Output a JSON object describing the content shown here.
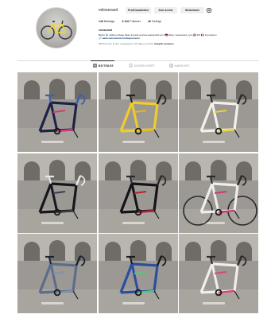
{
  "profile": {
    "username": "velosezard",
    "full_name": "velosezard",
    "avatar_alt": "Profilbild"
  },
  "buttons": {
    "edit_profile": "Profil bearbeiten",
    "archive": "Zum Archiv",
    "tools": "Werbetools"
  },
  "stats": {
    "posts_count": "143",
    "posts_label": "Beiträge",
    "followers_count": "3.126",
    "followers_label": "Follower",
    "following_count": "46",
    "following_label": "Gefolgt"
  },
  "bio": {
    "line1": "Berlin ⚙️ selling vintage bikes & parts at www.velosezard.com 🇩🇪 Ebay: velosezard_com 🇬🇧 FB: 🇫🇷 Impressum",
    "link": "www.velosezard.com/impressum"
  },
  "followed_by": {
    "text": "3600 Konten in den vergangenen 30 Tagen erreicht.",
    "cta": "Insights ansehen"
  },
  "tabs": [
    {
      "label": "BEITRÄGE",
      "icon": "grid-icon",
      "active": true
    },
    {
      "label": "GESPEICHERT",
      "icon": "bookmark-icon",
      "active": false
    },
    {
      "label": "MARKIERT",
      "icon": "tag-icon",
      "active": false
    }
  ],
  "posts": [
    {
      "alt": "pink and blue racing frame",
      "colors": {
        "main": "#1f2247",
        "accent": "#d9367a",
        "accent2": "#3a5fb5"
      }
    },
    {
      "alt": "yellow racing frame",
      "colors": {
        "main": "#f0cc2e",
        "accent": "#e6b820",
        "accent2": "#222222"
      }
    },
    {
      "alt": "white racing frame with yellow",
      "colors": {
        "main": "#f3f1ea",
        "accent": "#e9d43c",
        "accent2": "#2a2a2a"
      }
    },
    {
      "alt": "black racing frame",
      "colors": {
        "main": "#16161c",
        "accent": "#3c3c48",
        "accent2": "#e8e8e8"
      }
    },
    {
      "alt": "black frame with red details",
      "colors": {
        "main": "#141418",
        "accent": "#b52238",
        "accent2": "#2a2a2a"
      }
    },
    {
      "alt": "pink and white bicycle",
      "colors": {
        "main": "#eeeeea",
        "accent": "#cc3a74",
        "accent2": "#2a2a2a"
      }
    },
    {
      "alt": "blue-grey racing frame",
      "colors": {
        "main": "#5b6d8c",
        "accent": "#7f90ad",
        "accent2": "#1b2233"
      }
    },
    {
      "alt": "blue frame with green",
      "colors": {
        "main": "#2a4ea0",
        "accent": "#59c77a",
        "accent2": "#1a1a1a"
      }
    },
    {
      "alt": "white and pink frame",
      "colors": {
        "main": "#f2eeea",
        "accent": "#d6477c",
        "accent2": "#2a2a2a"
      }
    }
  ]
}
